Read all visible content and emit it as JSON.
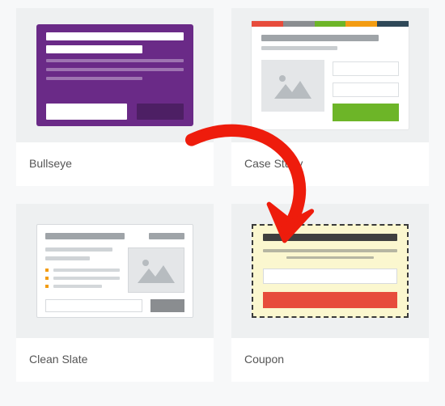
{
  "templates": [
    {
      "key": "bullseye",
      "label": "Bullseye"
    },
    {
      "key": "case_study",
      "label": "Case Study"
    },
    {
      "key": "clean_slate",
      "label": "Clean Slate"
    },
    {
      "key": "coupon",
      "label": "Coupon"
    }
  ],
  "annotation": {
    "arrow_from": "bullseye",
    "arrow_to": "coupon",
    "color": "#e91e0f"
  }
}
